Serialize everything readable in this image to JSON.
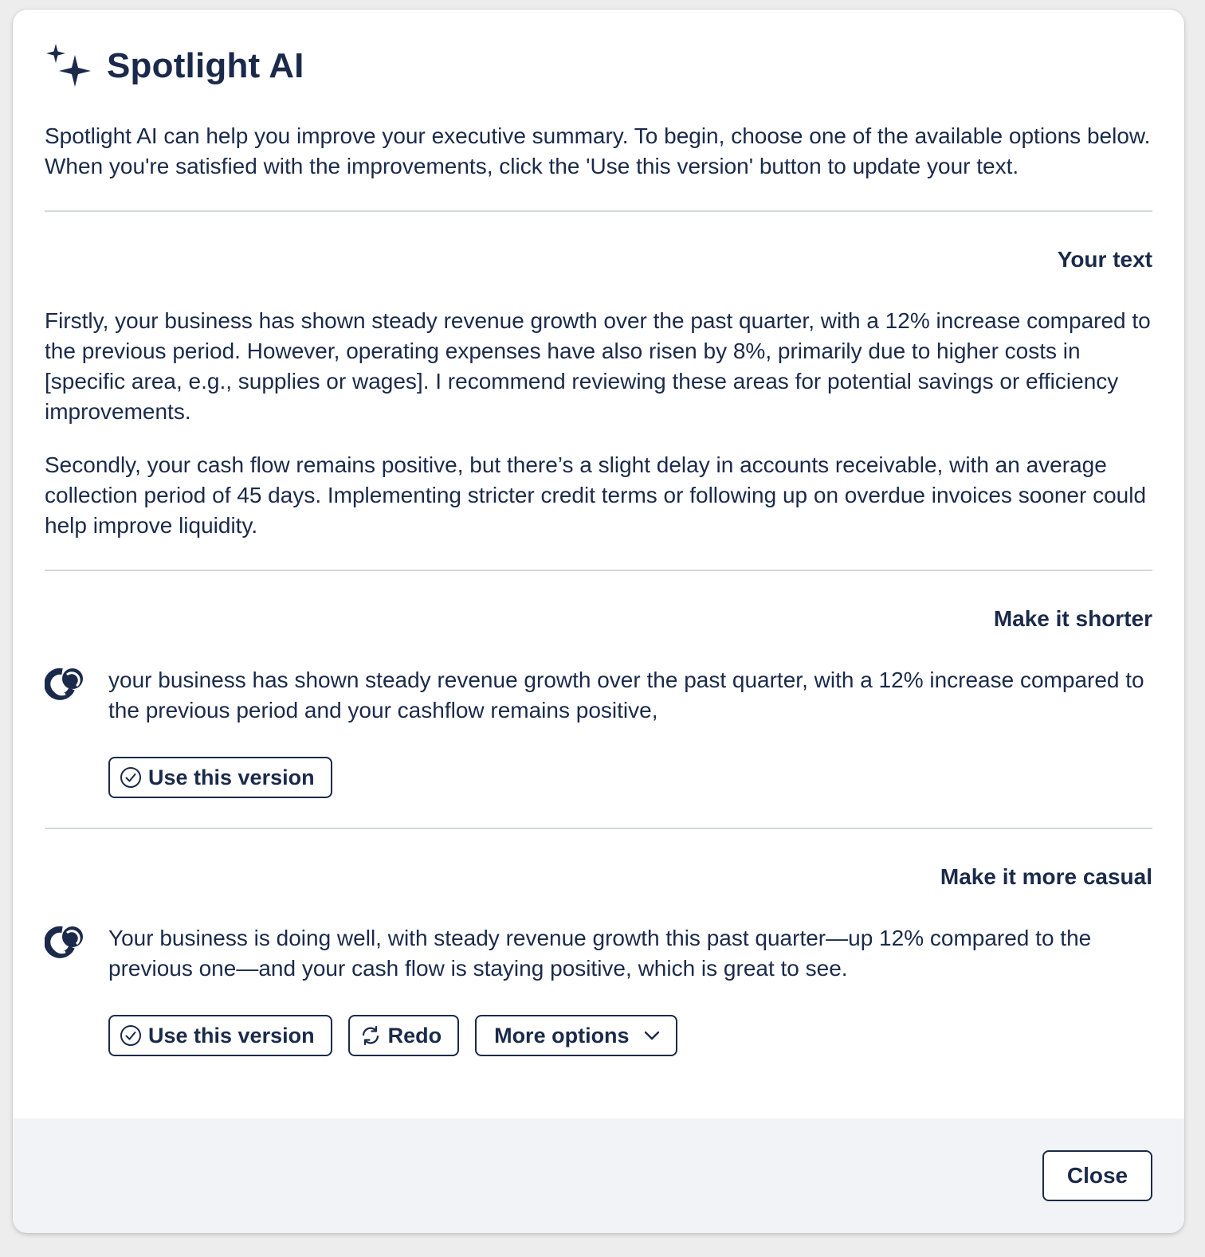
{
  "dialog": {
    "title": "Spotlight AI",
    "intro": "Spotlight AI can help you improve your executive summary. To begin, choose one of the available options below. When you're satisfied with the improvements, click the 'Use this version' button to update your text."
  },
  "your_text": {
    "heading": "Your text",
    "paragraphs": [
      "Firstly, your business has shown steady revenue growth over the past quarter, with a 12% increase compared to the previous period. However, operating expenses have also risen by 8%, primarily due to higher costs in [specific area, e.g., supplies or wages]. I recommend reviewing these areas for potential savings or efficiency improvements.",
      "Secondly, your cash flow remains positive, but there’s a slight delay in accounts receivable, with an average collection period of 45 days. Implementing stricter credit terms or following up on overdue invoices sooner could help improve liquidity."
    ]
  },
  "suggestions": [
    {
      "heading": "Make it shorter",
      "text": "your business has shown steady revenue growth over the past quarter, with a 12% increase compared to the previous period and your cashflow remains positive,",
      "use_label": "Use this version"
    },
    {
      "heading": "Make it more casual",
      "text": "Your business is doing well, with steady revenue growth this past quarter—up 12% compared to the previous one—and your cash flow is staying positive, which is great to see.",
      "use_label": "Use this version",
      "redo_label": "Redo",
      "more_label": "More options"
    }
  ],
  "footer": {
    "close_label": "Close"
  },
  "icons": {
    "title": "sparkle-icon",
    "ai": "spotlight-logo-icon",
    "use": "check-circle-icon",
    "redo": "refresh-icon",
    "more": "chevron-down-icon"
  },
  "colors": {
    "text": "#1b2a4a",
    "divider": "#d4d8de",
    "footer_bg": "#f2f3f6"
  }
}
